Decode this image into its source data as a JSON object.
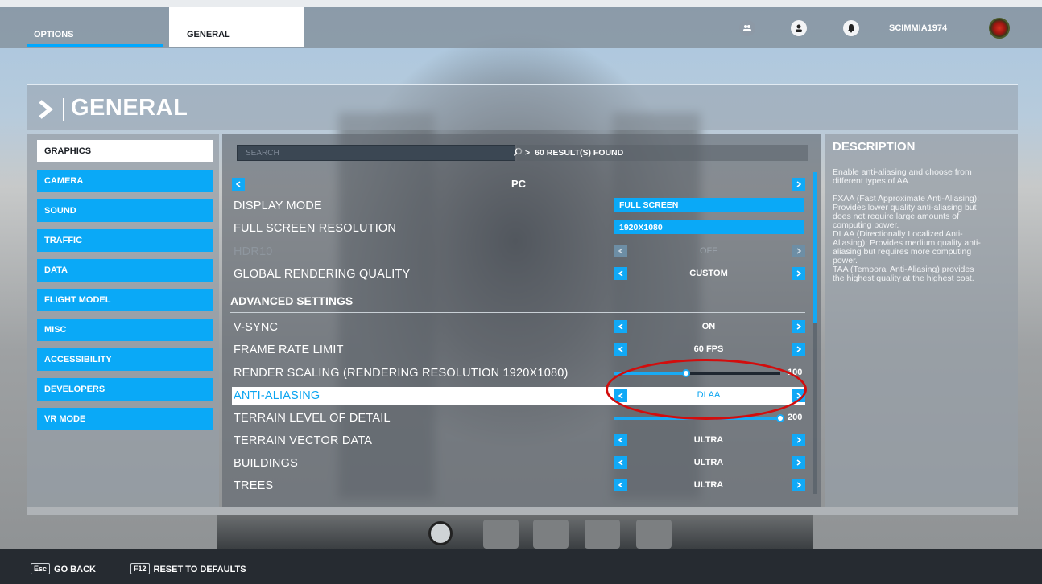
{
  "topbar": {
    "tab_options": "OPTIONS",
    "tab_general": "GENERAL",
    "username": "SCIMMIA1974",
    "icons": [
      "friends-icon",
      "profile-icon",
      "notifications-icon"
    ]
  },
  "header": {
    "title": "GENERAL"
  },
  "sidebar": {
    "items": [
      {
        "label": "GRAPHICS",
        "active": true
      },
      {
        "label": "CAMERA"
      },
      {
        "label": "SOUND"
      },
      {
        "label": "TRAFFIC"
      },
      {
        "label": "DATA"
      },
      {
        "label": "FLIGHT MODEL"
      },
      {
        "label": "MISC"
      },
      {
        "label": "ACCESSIBILITY"
      },
      {
        "label": "DEVELOPERS"
      },
      {
        "label": "VR MODE"
      }
    ]
  },
  "search": {
    "placeholder": "SEARCH",
    "results": "60 RESULT(S) FOUND"
  },
  "section": {
    "pc_label": "PC"
  },
  "settings": {
    "display_mode": {
      "label": "DISPLAY MODE",
      "value": "FULL SCREEN"
    },
    "resolution": {
      "label": "FULL SCREEN RESOLUTION",
      "value": "1920X1080"
    },
    "hdr10": {
      "label": "HDR10",
      "value": "OFF"
    },
    "global_quality": {
      "label": "GLOBAL RENDERING QUALITY",
      "value": "CUSTOM"
    },
    "advanced_title": "ADVANCED SETTINGS",
    "vsync": {
      "label": "V-SYNC",
      "value": "ON"
    },
    "frame_rate": {
      "label": "FRAME RATE LIMIT",
      "value": "60 FPS"
    },
    "render_scaling": {
      "label": "RENDER SCALING (RENDERING RESOLUTION 1920X1080)",
      "value": "100",
      "level": 0.43
    },
    "anti_aliasing": {
      "label": "ANTI-ALIASING",
      "value": "DLAA"
    },
    "terrain_lod": {
      "label": "TERRAIN LEVEL OF DETAIL",
      "value": "200",
      "level": 1.0
    },
    "terrain_vector": {
      "label": "TERRAIN VECTOR DATA",
      "value": "ULTRA"
    },
    "buildings": {
      "label": "BUILDINGS",
      "value": "ULTRA"
    },
    "trees": {
      "label": "TREES",
      "value": "ULTRA"
    }
  },
  "description": {
    "title": "DESCRIPTION",
    "text": "Enable anti-aliasing and choose from\ndifferent types of AA.\n\nFXAA (Fast Approximate Anti-Aliasing):\nProvides lower quality anti-aliasing but\ndoes not require large amounts of\ncomputing power.\nDLAA (Directionally Localized Anti-\nAliasing): Provides medium quality anti-\naliasing but requires more computing\npower.\nTAA (Temporal Anti-Aliasing) provides\nthe highest quality at the highest cost."
  },
  "bottombar": {
    "back_key": "Esc",
    "back_label": "GO BACK",
    "reset_key": "F12",
    "reset_label": "RESET TO DEFAULTS"
  },
  "colors": {
    "accent": "#0aa9f7",
    "highlight_ring": "#d20d0d"
  }
}
